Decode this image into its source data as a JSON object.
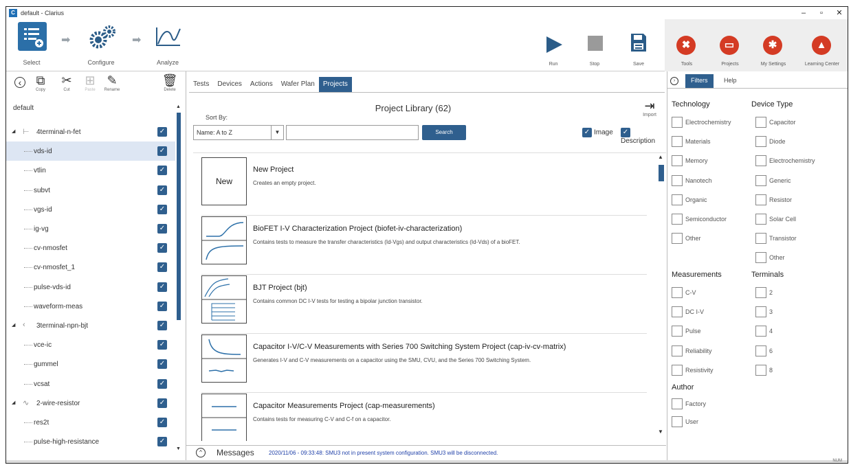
{
  "window": {
    "title": "default - Clarius",
    "minimize": "–",
    "maximize": "▫",
    "close": "✕"
  },
  "flow": {
    "select": "Select",
    "configure": "Configure",
    "analyze": "Analyze"
  },
  "actions": {
    "run": "Run",
    "stop": "Stop",
    "save": "Save"
  },
  "right_tools": {
    "tools": "Tools",
    "projects": "Projects",
    "settings": "My Settings",
    "learning": "Learning Center"
  },
  "left_toolbar": {
    "copy": "Copy",
    "cut": "Cut",
    "paste": "Paste",
    "rename": "Rename",
    "delete": "Delete"
  },
  "tree": {
    "root": "default",
    "devices": [
      "4terminal-n-fet",
      "3terminal-npn-bjt",
      "2-wire-resistor"
    ],
    "tests": [
      "vds-id",
      "vtlin",
      "subvt",
      "vgs-id",
      "ig-vg",
      "cv-nmosfet",
      "cv-nmosfet_1",
      "pulse-vds-id",
      "waveform-meas",
      "vce-ic",
      "gummel",
      "vcsat",
      "res2t",
      "pulse-high-resistance"
    ]
  },
  "tabs": [
    "Tests",
    "Devices",
    "Actions",
    "Wafer Plan",
    "Projects"
  ],
  "library": {
    "title": "Project Library (62)",
    "import": "Import",
    "sort_by": "Sort By:",
    "sort_value": "Name: A to Z",
    "search_button": "Search",
    "image_label": "Image",
    "description_label": "Description"
  },
  "projects": [
    {
      "name": "New Project",
      "thumb": "New",
      "desc": "Creates an empty project."
    },
    {
      "name": "BioFET I-V Characterization Project (biofet-iv-characterization)",
      "desc": "Contains tests to measure the transfer characteristics (Id-Vgs) and output characteristics (Id-Vds) of a bioFET."
    },
    {
      "name": "BJT Project (bjt)",
      "desc": "Contains common DC I-V tests for testing a bipolar junction transistor."
    },
    {
      "name": "Capacitor I-V/C-V Measurements with Series 700 Switching System Project (cap-iv-cv-matrix)",
      "desc": "Generates I-V and C-V measurements on a capacitor using the SMU, CVU, and the Series 700 Switching System."
    },
    {
      "name": "Capacitor Measurements Project (cap-measurements)",
      "desc": "Contains tests for measuring C-V and C-f on a capacitor."
    }
  ],
  "messages": {
    "title": "Messages",
    "text": "2020/11/06 - 09:33:48: SMU3 not in present system configuration. SMU3 will be disconnected."
  },
  "filters": {
    "tab_filters": "Filters",
    "tab_help": "Help",
    "technology_title": "Technology",
    "technology": [
      "Electrochemistry",
      "Materials",
      "Memory",
      "Nanotech",
      "Organic",
      "Semiconductor",
      "Other"
    ],
    "device_type_title": "Device Type",
    "device_type": [
      "Capacitor",
      "Diode",
      "Electrochemistry",
      "Generic",
      "Resistor",
      "Solar Cell",
      "Transistor",
      "Other"
    ],
    "measurements_title": "Measurements",
    "measurements": [
      "C-V",
      "DC I-V",
      "Pulse",
      "Reliability",
      "Resistivity"
    ],
    "terminals_title": "Terminals",
    "terminals": [
      "2",
      "3",
      "4",
      "6",
      "8"
    ],
    "author_title": "Author",
    "author": [
      "Factory",
      "User"
    ]
  },
  "status": {
    "num": "NUM"
  },
  "colors": {
    "accent": "#2f5f8e",
    "danger": "#d43b24",
    "message": "#1e3fa8"
  }
}
